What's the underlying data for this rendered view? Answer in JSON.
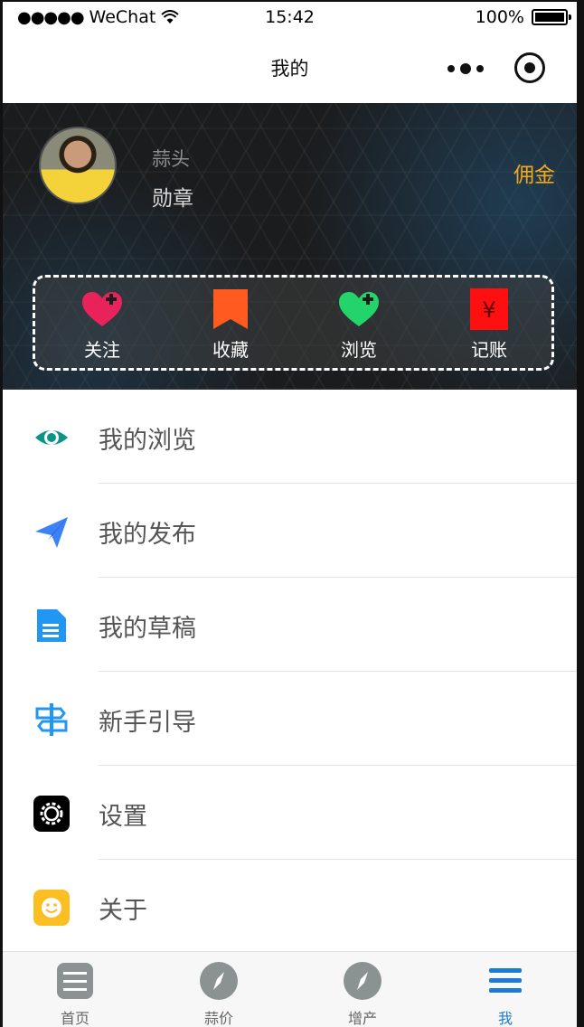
{
  "status_bar": {
    "signal": "●●●●●",
    "carrier": "WeChat",
    "time": "15:42",
    "battery": "100%"
  },
  "nav": {
    "title": "我的"
  },
  "profile": {
    "name": "蒜头",
    "badge": "勋章",
    "commission": "佣金"
  },
  "actions": [
    {
      "label": "关注",
      "icon": "heart-plus-icon",
      "color": "#e8225a"
    },
    {
      "label": "收藏",
      "icon": "bookmark-icon",
      "color": "#ff5a1f"
    },
    {
      "label": "浏览",
      "icon": "heart-plus-icon",
      "color": "#22d46a"
    },
    {
      "label": "记账",
      "icon": "yen-icon",
      "color": "#ff1010"
    }
  ],
  "menu": [
    {
      "label": "我的浏览",
      "icon": "eye-icon",
      "color": "#0d9488"
    },
    {
      "label": "我的发布",
      "icon": "paper-plane-icon",
      "color": "#3b82f6"
    },
    {
      "label": "我的草稿",
      "icon": "document-icon",
      "color": "#2196f3"
    },
    {
      "label": "新手引导",
      "icon": "signpost-icon",
      "color": "#2196f3"
    },
    {
      "label": "设置",
      "icon": "gear-icon",
      "color": "#000000"
    },
    {
      "label": "关于",
      "icon": "smile-icon",
      "color": "#fbbf24"
    }
  ],
  "tabs": [
    {
      "label": "首页",
      "icon": "home-list-icon",
      "active": false
    },
    {
      "label": "蒜价",
      "icon": "compass-icon",
      "active": false
    },
    {
      "label": "增产",
      "icon": "compass-icon",
      "active": false
    },
    {
      "label": "我",
      "icon": "menu-icon",
      "active": true
    }
  ]
}
